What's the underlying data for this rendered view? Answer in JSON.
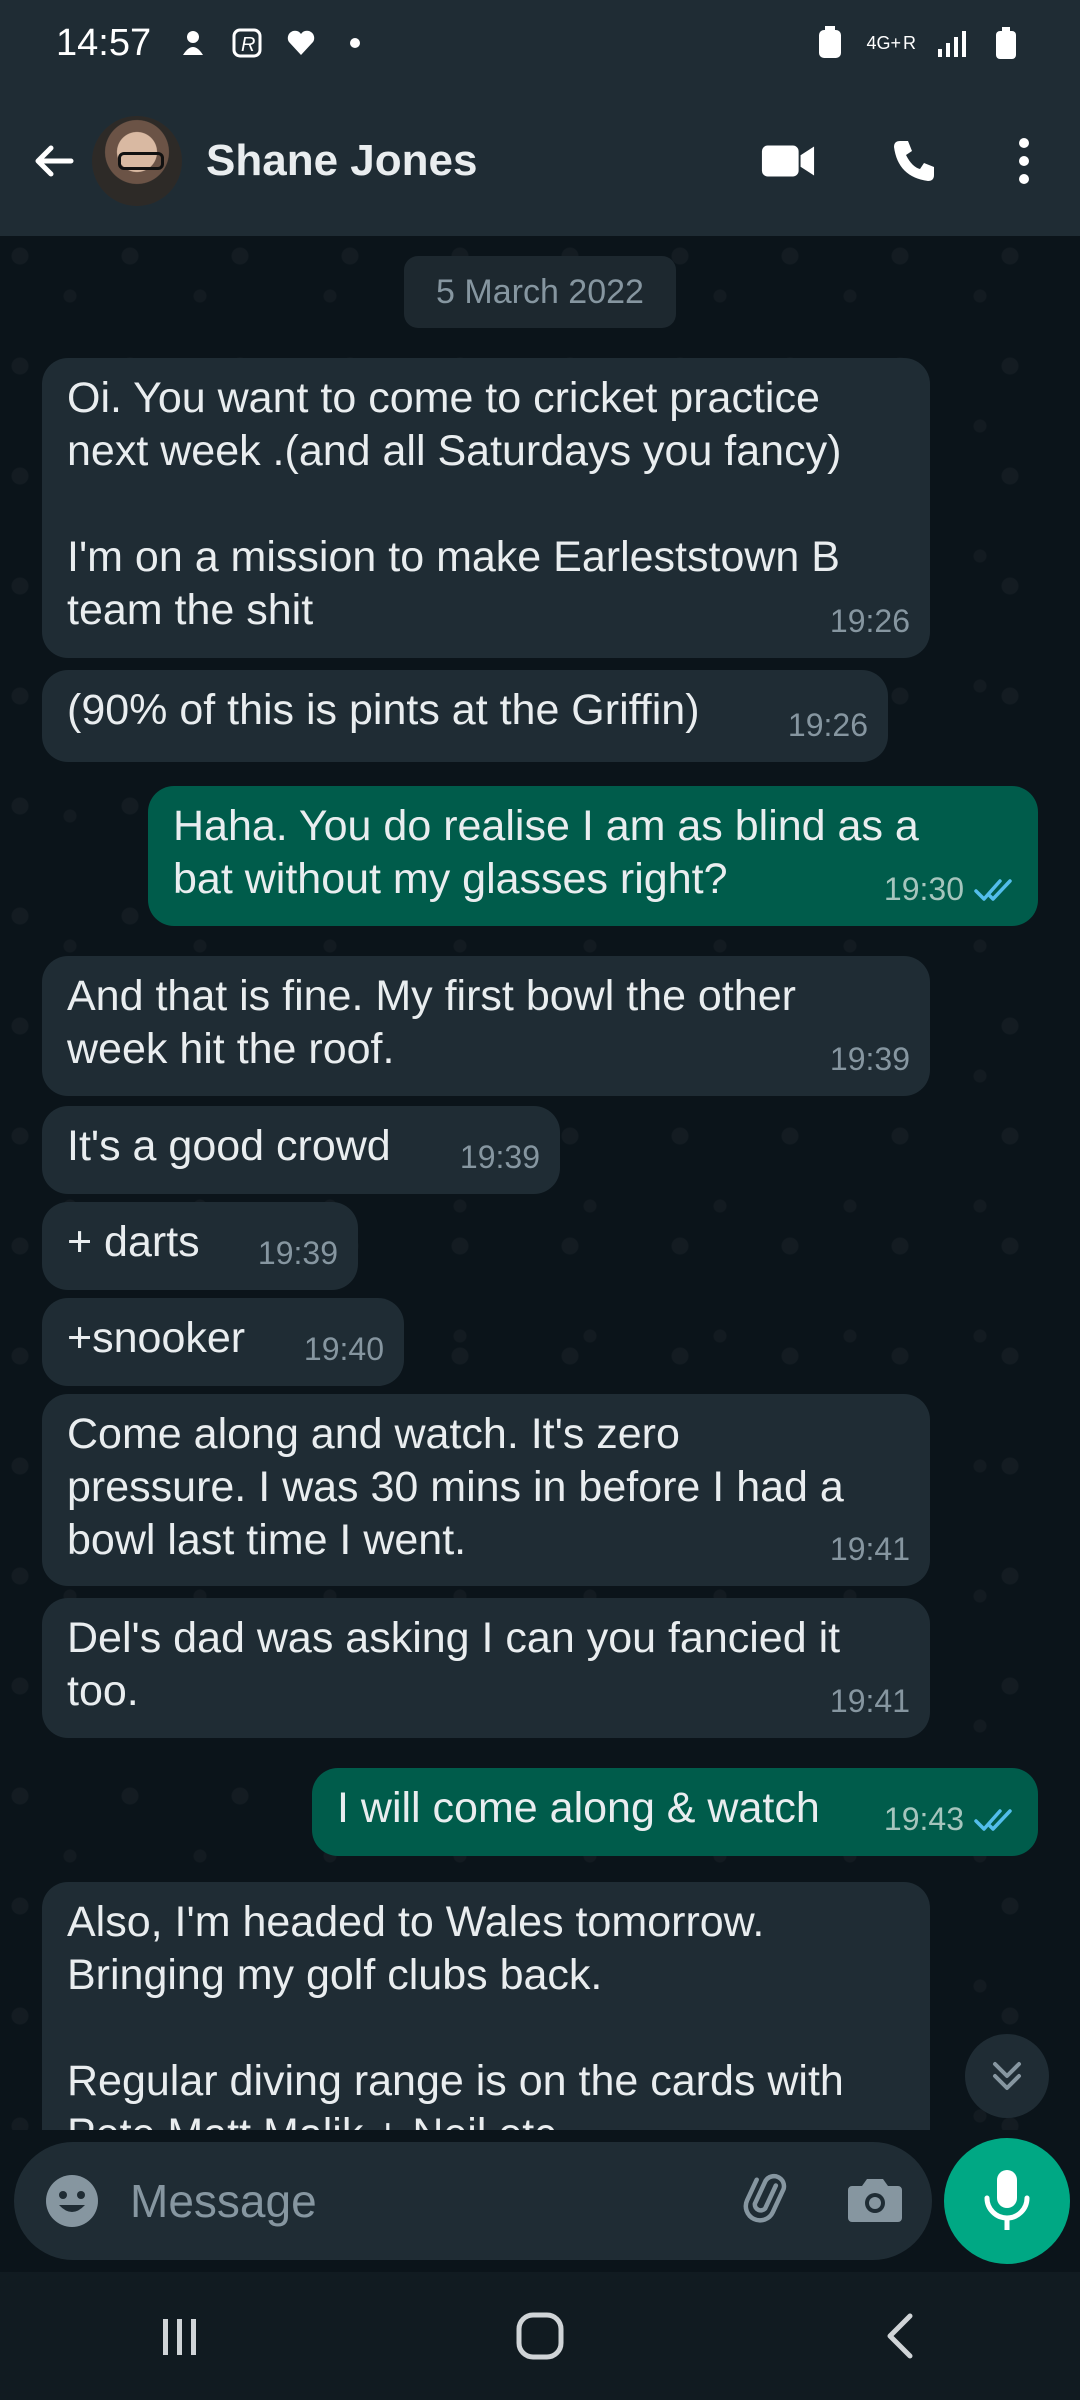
{
  "status_bar": {
    "time": "14:57",
    "network": "4G+",
    "roaming": "R",
    "left_icons": [
      "notification-icon-1",
      "r-app-icon",
      "heart-icon",
      "dot-icon"
    ],
    "right_icons": [
      "battery-saver-icon",
      "network-4g-icon",
      "signal-icon",
      "battery-icon"
    ]
  },
  "header": {
    "contact_name": "Shane Jones",
    "icons": [
      "back-arrow-icon",
      "video-call-icon",
      "phone-call-icon",
      "more-options-icon"
    ]
  },
  "chat": {
    "date_chip": "5 March 2022",
    "messages": [
      {
        "dir": "in",
        "text": "Oi. You want to come to cricket practice\nnext week .(and all Saturdays you fancy)\n\nI'm on a mission to make Earleststown B\nteam the shit",
        "time": "19:26"
      },
      {
        "dir": "in",
        "text": "(90% of this is pints at the Griffin)",
        "time": "19:26"
      },
      {
        "dir": "out",
        "text": "Haha. You do realise I am as blind as a\nbat without my glasses right?",
        "time": "19:30",
        "status": "read"
      },
      {
        "dir": "in",
        "text": "And that is fine. My first bowl the other\nweek hit the roof.",
        "time": "19:39"
      },
      {
        "dir": "in",
        "text": "It's a good crowd",
        "time": "19:39"
      },
      {
        "dir": "in",
        "text": "+ darts",
        "time": "19:39"
      },
      {
        "dir": "in",
        "text": "+snooker",
        "time": "19:40"
      },
      {
        "dir": "in",
        "text": "Come along and watch. It's zero\npressure. I was 30 mins in before I had a\nbowl last time I went.",
        "time": "19:41"
      },
      {
        "dir": "in",
        "text": "Del's dad was asking I can you fancied it\ntoo.",
        "time": "19:41"
      },
      {
        "dir": "out",
        "text": "I will come along & watch",
        "time": "19:43",
        "status": "read"
      },
      {
        "dir": "in",
        "text": "Also, I'm headed to Wales tomorrow.\nBringing my golf clubs back.\n\nRegular diving range is on the cards with\nPete Matt Malik + Neil etc",
        "time": ""
      }
    ]
  },
  "input": {
    "placeholder": "Message",
    "icons": [
      "emoji-icon",
      "attach-icon",
      "camera-icon",
      "microphone-icon"
    ]
  },
  "colors": {
    "background": "#0b141a",
    "header": "#1f2c34",
    "incoming_bubble": "#1f2c34",
    "outgoing_bubble": "#005c4b",
    "accent": "#00a884",
    "read_tick": "#53bdeb"
  }
}
